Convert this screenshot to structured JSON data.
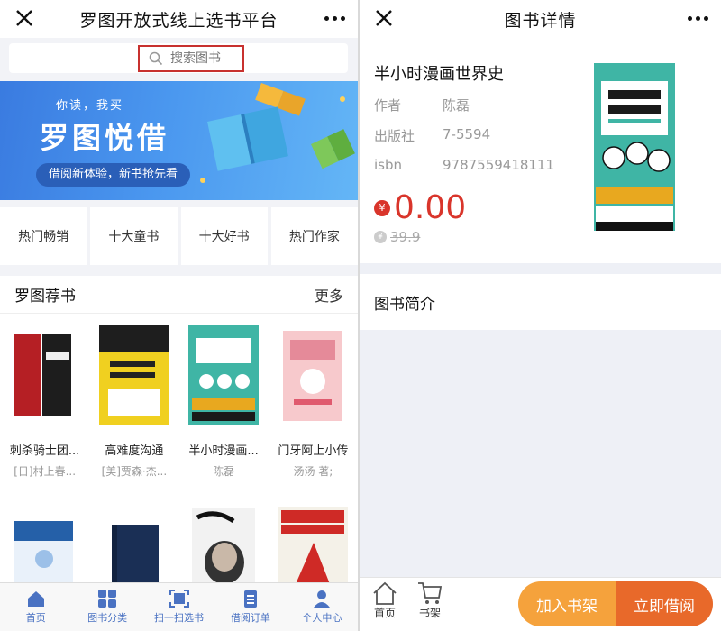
{
  "left": {
    "header": {
      "title": "罗图开放式线上选书平台"
    },
    "search": {
      "placeholder": "搜索图书"
    },
    "banner": {
      "line1": "你读，我买",
      "title": "罗图悦借",
      "tagline": "借阅新体验，新书抢先看"
    },
    "tags": [
      "热门畅销",
      "十大童书",
      "十大好书",
      "热门作家"
    ],
    "recommend": {
      "title": "罗图荐书",
      "more": "更多",
      "books": [
        {
          "title": "刺杀骑士团...",
          "author": "[日]村上春..."
        },
        {
          "title": "高难度沟通",
          "author": "[美]贾森·杰..."
        },
        {
          "title": "半小时漫画...",
          "author": "陈磊"
        },
        {
          "title": "门牙阿上小传",
          "author": "汤汤 著;"
        }
      ]
    },
    "tabbar": [
      "首页",
      "图书分类",
      "扫一扫选书",
      "借阅订单",
      "个人中心"
    ],
    "accent": "#4a72c2"
  },
  "right": {
    "header": {
      "title": "图书详情"
    },
    "book": {
      "name": "半小时漫画世界史",
      "author_label": "作者",
      "author": "陈磊",
      "publisher_label": "出版社",
      "publisher": "7-5594",
      "isbn_label": "isbn",
      "isbn": "9787559418111",
      "price": "0.00",
      "original_price": "39.9",
      "currency_symbol": "¥"
    },
    "intro_title": "图书简介",
    "bottom": {
      "home": "首页",
      "shelf": "书架",
      "add_button": "加入书架",
      "borrow_button": "立即借阅"
    },
    "price_color": "#d9352b"
  }
}
